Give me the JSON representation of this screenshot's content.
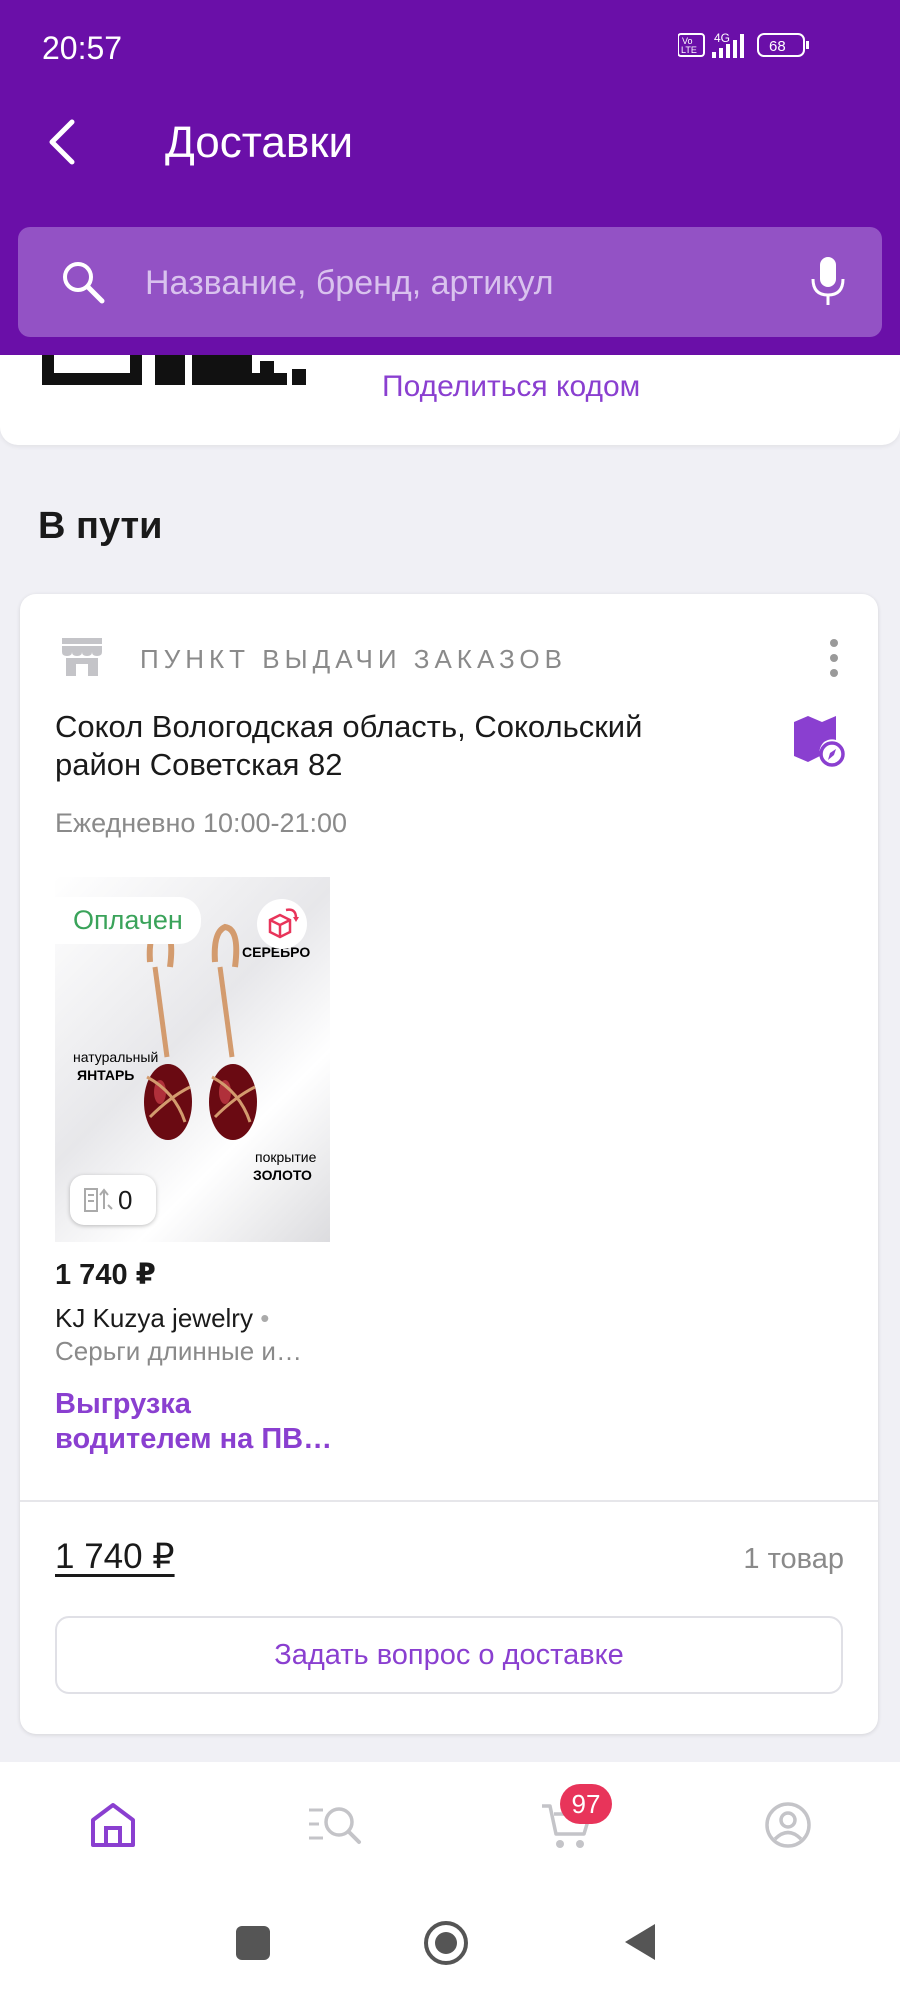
{
  "status_bar": {
    "time": "20:57",
    "signal": "4G",
    "battery": "68"
  },
  "header": {
    "title": "Доставки"
  },
  "search": {
    "placeholder": "Название, бренд, артикул"
  },
  "share_card": {
    "share_link": "Поделиться кодом"
  },
  "section": {
    "title": "В пути"
  },
  "delivery": {
    "pickup_label": "ПУНКТ ВЫДАЧИ ЗАКАЗОВ",
    "address": "Сокол Вологодская область, Сокольский район Советская 82",
    "hours": "Ежедневно 10:00-21:00",
    "product": {
      "status_badge": "Оплачен",
      "image_texts": {
        "silver": "СЕРЕБРО",
        "amber_top": "натуральный",
        "amber": "ЯНТАРЬ",
        "gold_top": "покрытие",
        "gold": "ЗОЛОТО"
      },
      "compare_count": "0",
      "price": "1 740 ₽",
      "brand": "KJ Kuzya jewelry",
      "name": "Серьги длинные и…",
      "delivery_status": "Выгрузка водителем на ПВ…"
    },
    "total": "1 740 ₽",
    "item_count": "1 товар",
    "ask_button": "Задать вопрос о доставке"
  },
  "bottom_nav": {
    "cart_badge": "97"
  },
  "colors": {
    "header": "#6a0fa8",
    "accent": "#8a3fd0",
    "paid": "#3aa35a",
    "badge": "#e8345a"
  }
}
